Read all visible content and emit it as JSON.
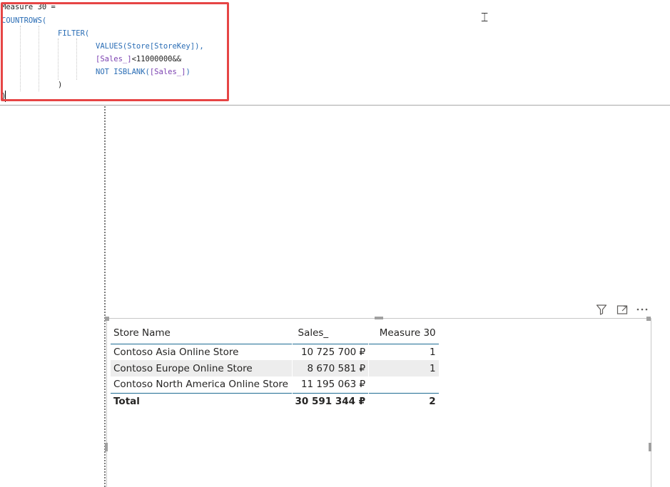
{
  "formula_bar": {
    "lines": {
      "l1": "Measure 30 =",
      "l2": "COUNTROWS(",
      "l3": "FILTER(",
      "l4_fn": "VALUES(Store[StoreKey]),",
      "l5_ref": "[Sales_]",
      "l5_rest": "<11000000&&",
      "l6_kw": "NOT ISBLANK(",
      "l6_ref": "[Sales_]",
      "l6_end": ")",
      "l7": ")",
      "l8": ")"
    },
    "highlight_color": "#e64545"
  },
  "visual_header": {
    "icons": [
      "filter-icon",
      "focus-mode-icon",
      "more-options-icon"
    ]
  },
  "table": {
    "columns": [
      "Store Name",
      "Sales_",
      "Measure 30"
    ],
    "rows": [
      {
        "store": "Contoso Asia Online Store",
        "sales": "10 725 700 ₽",
        "measure": "1"
      },
      {
        "store": "Contoso Europe Online Store",
        "sales": "8 670 581 ₽",
        "measure": "1"
      },
      {
        "store": "Contoso North America Online Store",
        "sales": "11 195 063 ₽",
        "measure": ""
      }
    ],
    "total": {
      "label": "Total",
      "sales": "30 591 344 ₽",
      "measure": "2"
    },
    "accent_color": "#1e6c93",
    "stripe_color": "#ededed"
  }
}
